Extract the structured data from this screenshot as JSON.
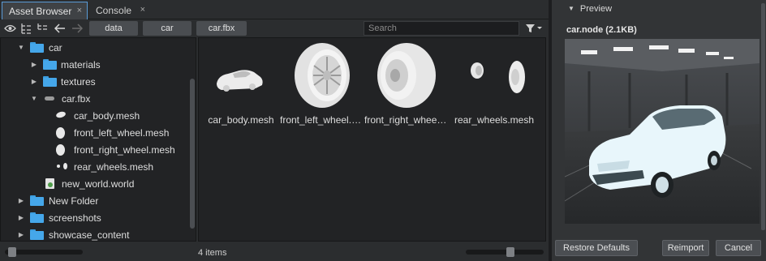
{
  "tabs": [
    {
      "label": "Asset Browser",
      "close": "×"
    },
    {
      "label": "Console",
      "close": "×"
    }
  ],
  "toolbar": {
    "icons": [
      "eye-icon",
      "expand-tree-icon",
      "collapse-tree-icon",
      "back-arrow-icon",
      "forward-arrow-icon",
      "filter-icon"
    ],
    "breadcrumbs": [
      "data",
      "car",
      "car.fbx"
    ],
    "search_placeholder": "Search"
  },
  "tree": {
    "items": [
      {
        "label": "car",
        "type": "folder",
        "expanded": true
      },
      {
        "label": "materials",
        "type": "folder",
        "expanded": false
      },
      {
        "label": "textures",
        "type": "folder",
        "expanded": false
      },
      {
        "label": "car.fbx",
        "type": "fbx",
        "expanded": true
      },
      {
        "label": "car_body.mesh",
        "type": "mesh"
      },
      {
        "label": "front_left_wheel.mesh",
        "type": "mesh"
      },
      {
        "label": "front_right_wheel.mesh",
        "type": "mesh"
      },
      {
        "label": "rear_wheels.mesh",
        "type": "mesh"
      },
      {
        "label": "new_world.world",
        "type": "world"
      },
      {
        "label": "New Folder",
        "type": "folder",
        "expanded": false
      },
      {
        "label": "screenshots",
        "type": "folder",
        "expanded": false
      },
      {
        "label": "showcase_content",
        "type": "folder",
        "expanded": false
      }
    ]
  },
  "grid": {
    "assets": [
      {
        "name": "car_body.mesh"
      },
      {
        "name": "front_left_wheel.mesh"
      },
      {
        "name": "front_right_wheel.mesh"
      },
      {
        "name": "rear_wheels.mesh"
      }
    ]
  },
  "status": {
    "item_count": "4 items"
  },
  "preview": {
    "header": "Preview",
    "node_title": "car.node (2.1KB)"
  },
  "buttons": {
    "restore_defaults": "Restore Defaults",
    "reimport": "Reimport",
    "cancel": "Cancel"
  },
  "colors": {
    "accent": "#5a9bd6",
    "folder": "#45a7ea",
    "panel_bg": "#222325",
    "window_bg": "#2b2d2f"
  }
}
